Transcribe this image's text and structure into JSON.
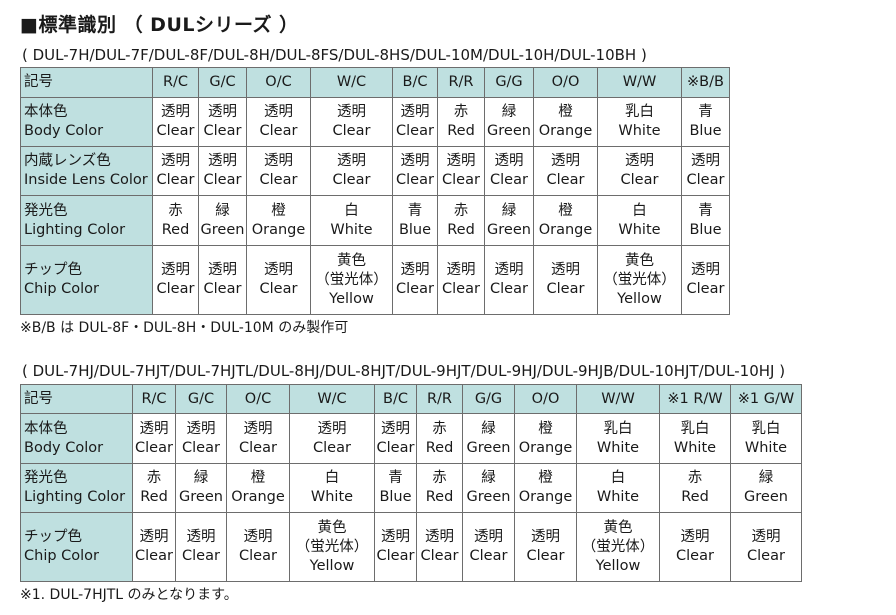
{
  "title": "■標準識別 （ DULシリーズ ）",
  "table1": {
    "models": "( DUL-7H/DUL-7F/DUL-8F/DUL-8H/DUL-8FS/DUL-8HS/DUL-10M/DUL-10H/DUL-10BH )",
    "headers": [
      "記号",
      "R/C",
      "G/C",
      "O/C",
      "W/C",
      "B/C",
      "R/R",
      "G/G",
      "O/O",
      "W/W",
      "※B/B"
    ],
    "rows": [
      {
        "label_jp": "本体色",
        "label_en": "Body Color",
        "cells": [
          [
            "透明",
            "Clear"
          ],
          [
            "透明",
            "Clear"
          ],
          [
            "透明",
            "Clear"
          ],
          [
            "透明",
            "Clear"
          ],
          [
            "透明",
            "Clear"
          ],
          [
            "赤",
            "Red"
          ],
          [
            "緑",
            "Green"
          ],
          [
            "橙",
            "Orange"
          ],
          [
            "乳白",
            "White"
          ],
          [
            "青",
            "Blue"
          ]
        ]
      },
      {
        "label_jp": "内蔵レンズ色",
        "label_en": "Inside Lens Color",
        "cells": [
          [
            "透明",
            "Clear"
          ],
          [
            "透明",
            "Clear"
          ],
          [
            "透明",
            "Clear"
          ],
          [
            "透明",
            "Clear"
          ],
          [
            "透明",
            "Clear"
          ],
          [
            "透明",
            "Clear"
          ],
          [
            "透明",
            "Clear"
          ],
          [
            "透明",
            "Clear"
          ],
          [
            "透明",
            "Clear"
          ],
          [
            "透明",
            "Clear"
          ]
        ]
      },
      {
        "label_jp": "発光色",
        "label_en": "Lighting Color",
        "cells": [
          [
            "赤",
            "Red"
          ],
          [
            "緑",
            "Green"
          ],
          [
            "橙",
            "Orange"
          ],
          [
            "白",
            "White"
          ],
          [
            "青",
            "Blue"
          ],
          [
            "赤",
            "Red"
          ],
          [
            "緑",
            "Green"
          ],
          [
            "橙",
            "Orange"
          ],
          [
            "白",
            "White"
          ],
          [
            "青",
            "Blue"
          ]
        ]
      },
      {
        "label_jp": "チップ色",
        "label_en": "Chip Color",
        "cells": [
          [
            "透明",
            "Clear"
          ],
          [
            "透明",
            "Clear"
          ],
          [
            "透明",
            "Clear"
          ],
          [
            "黄色",
            "（蛍光体）",
            "Yellow"
          ],
          [
            "透明",
            "Clear"
          ],
          [
            "透明",
            "Clear"
          ],
          [
            "透明",
            "Clear"
          ],
          [
            "透明",
            "Clear"
          ],
          [
            "黄色",
            "（蛍光体）",
            "Yellow"
          ],
          [
            "透明",
            "Clear"
          ]
        ]
      }
    ],
    "note": "※B/B は DUL-8F・DUL-8H・DUL-10M のみ製作可"
  },
  "table2": {
    "models": "( DUL-7HJ/DUL-7HJT/DUL-7HJTL/DUL-8HJ/DUL-8HJT/DUL-9HJT/DUL-9HJ/DUL-9HJB/DUL-10HJT/DUL-10HJ )",
    "headers": [
      "記号",
      "R/C",
      "G/C",
      "O/C",
      "W/C",
      "B/C",
      "R/R",
      "G/G",
      "O/O",
      "W/W",
      "※1 R/W",
      "※1 G/W"
    ],
    "rows": [
      {
        "label_jp": "本体色",
        "label_en": "Body Color",
        "cells": [
          [
            "透明",
            "Clear"
          ],
          [
            "透明",
            "Clear"
          ],
          [
            "透明",
            "Clear"
          ],
          [
            "透明",
            "Clear"
          ],
          [
            "透明",
            "Clear"
          ],
          [
            "赤",
            "Red"
          ],
          [
            "緑",
            "Green"
          ],
          [
            "橙",
            "Orange"
          ],
          [
            "乳白",
            "White"
          ],
          [
            "乳白",
            "White"
          ],
          [
            "乳白",
            "White"
          ]
        ]
      },
      {
        "label_jp": "発光色",
        "label_en": "Lighting Color",
        "cells": [
          [
            "赤",
            "Red"
          ],
          [
            "緑",
            "Green"
          ],
          [
            "橙",
            "Orange"
          ],
          [
            "白",
            "White"
          ],
          [
            "青",
            "Blue"
          ],
          [
            "赤",
            "Red"
          ],
          [
            "緑",
            "Green"
          ],
          [
            "橙",
            "Orange"
          ],
          [
            "白",
            "White"
          ],
          [
            "赤",
            "Red"
          ],
          [
            "緑",
            "Green"
          ]
        ]
      },
      {
        "label_jp": "チップ色",
        "label_en": "Chip Color",
        "cells": [
          [
            "透明",
            "Clear"
          ],
          [
            "透明",
            "Clear"
          ],
          [
            "透明",
            "Clear"
          ],
          [
            "黄色",
            "（蛍光体）",
            "Yellow"
          ],
          [
            "透明",
            "Clear"
          ],
          [
            "透明",
            "Clear"
          ],
          [
            "透明",
            "Clear"
          ],
          [
            "透明",
            "Clear"
          ],
          [
            "黄色",
            "（蛍光体）",
            "Yellow"
          ],
          [
            "透明",
            "Clear"
          ],
          [
            "透明",
            "Clear"
          ]
        ]
      }
    ],
    "note": "※1. DUL-7HJTL のみとなります。"
  }
}
